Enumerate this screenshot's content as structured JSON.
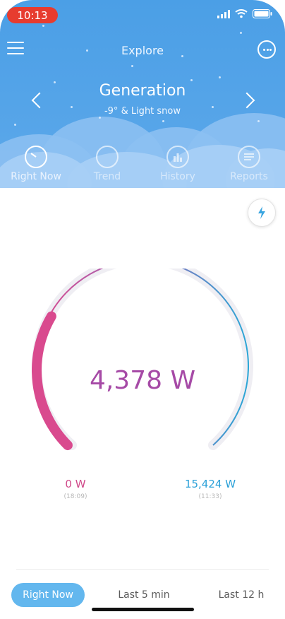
{
  "status": {
    "time": "10:13"
  },
  "header": {
    "title": "Explore",
    "location": "Generation",
    "weather": "-9° & Light snow"
  },
  "tabs": [
    {
      "label": "Right Now"
    },
    {
      "label": "Trend"
    },
    {
      "label": "History"
    },
    {
      "label": "Reports"
    }
  ],
  "gauge": {
    "value_text": "4,378 W",
    "current_fraction": 0.28,
    "min_label": "0 W",
    "min_time": "(18:09)",
    "max_label": "15,424 W",
    "max_time": "(11:33)"
  },
  "bottom": {
    "buttons": [
      {
        "label": "Right Now"
      },
      {
        "label": "Last 5 min"
      },
      {
        "label": "Last 12 h"
      }
    ]
  },
  "colors": {
    "accent": "#63b7ee",
    "min_color": "#d04a8a",
    "max_color": "#2aa0d8"
  }
}
